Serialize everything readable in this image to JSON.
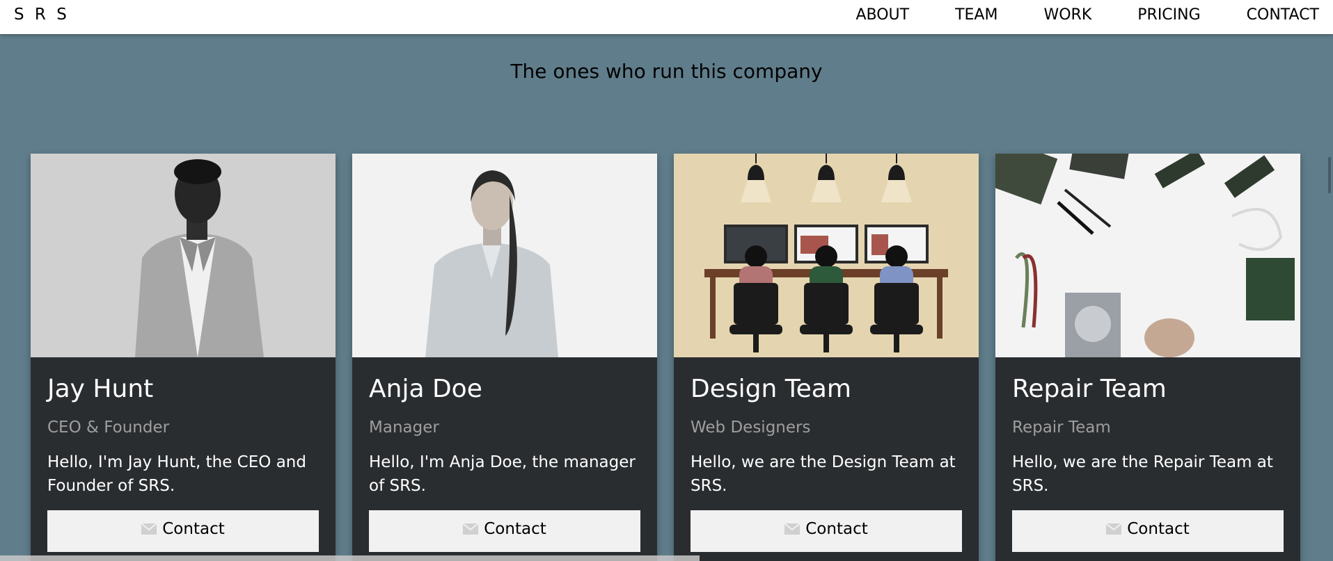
{
  "brand": "S R S",
  "nav": {
    "links": [
      "ABOUT",
      "TEAM",
      "WORK",
      "PRICING",
      "CONTACT"
    ]
  },
  "team": {
    "title": "The ones who run this company",
    "cards": [
      {
        "name": "Jay Hunt",
        "role": "CEO & Founder",
        "description": "Hello, I'm Jay Hunt, the CEO and Founder of SRS.",
        "button": "Contact"
      },
      {
        "name": "Anja Doe",
        "role": "Manager",
        "description": "Hello, I'm Anja Doe, the manager of SRS.",
        "button": "Contact"
      },
      {
        "name": "Design Team",
        "role": "Web Designers",
        "description": "Hello, we are the Design Team at SRS.",
        "button": "Contact"
      },
      {
        "name": "Repair Team",
        "role": "Repair Team",
        "description": "Hello, we are the Repair Team at SRS.",
        "button": "Contact"
      }
    ]
  },
  "colors": {
    "background": "#607d8b",
    "navbar": "#ffffff",
    "card": "#2a2d30",
    "role_text": "#9e9e9e",
    "button": "#f1f1f1"
  }
}
